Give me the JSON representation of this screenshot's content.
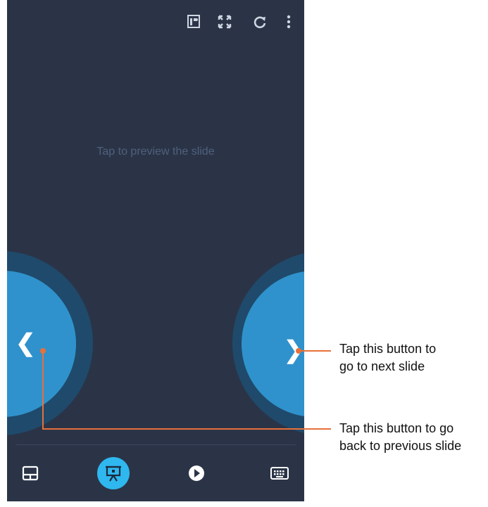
{
  "app": {
    "preview_hint": "Tap to preview the slide",
    "top_icons": [
      "presenter-notes-icon",
      "fullscreen-icon",
      "refresh-icon",
      "more-vert-icon"
    ],
    "bottom_icons": [
      "touchpad-icon",
      "presentation-icon",
      "play-icon",
      "keyboard-icon"
    ],
    "prev_glyph": "❮",
    "next_glyph": "❯",
    "colors": {
      "background": "#2b3447",
      "nav_button": "#2f92cc",
      "nav_ring": "#1f4a6b",
      "active_tab": "#2fb7ef",
      "callout_line": "#e8703a"
    }
  },
  "callouts": {
    "next_line1": "Tap this button to",
    "next_line2": "go to next slide",
    "prev_line1": "Tap this button to go",
    "prev_line2": "back to previous slide"
  }
}
